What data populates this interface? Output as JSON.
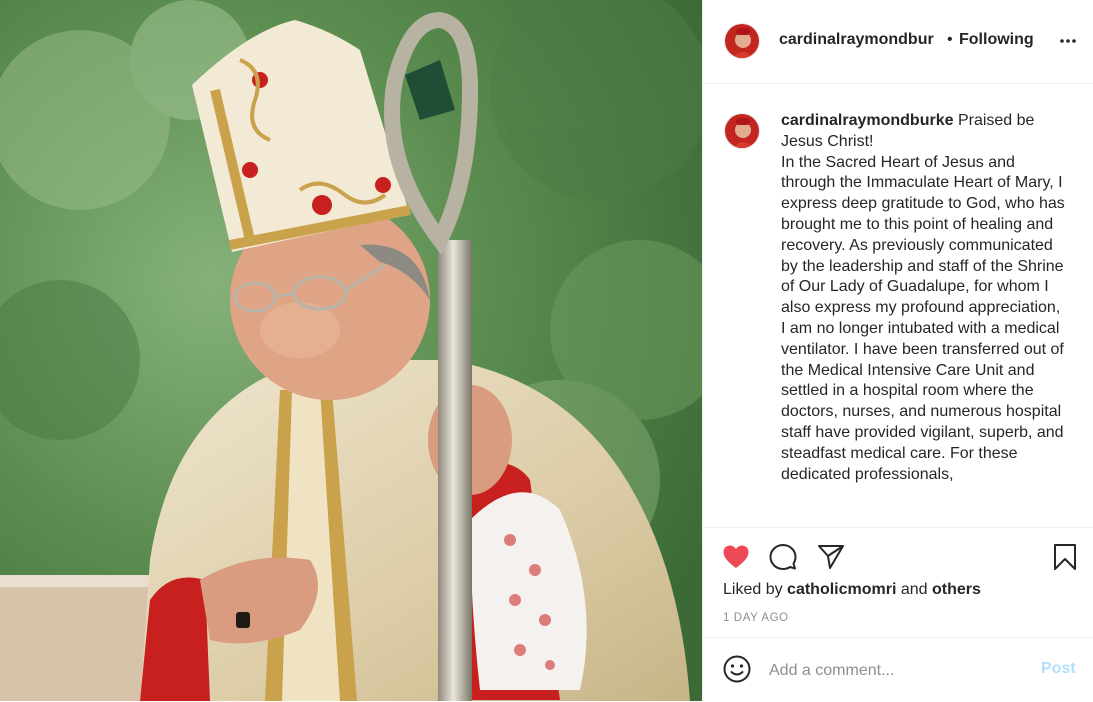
{
  "post": {
    "username": "cardinalraymondbur",
    "separator": "•",
    "follow_status": "Following",
    "more_icon": "more-horizontal-icon"
  },
  "caption": {
    "username": "cardinalraymondburke",
    "text": "Praised be Jesus Christ!\nIn the Sacred Heart of Jesus and through the Immaculate Heart of Mary, I express deep gratitude to God, who has brought me to this point of healing and recovery. As previously communicated by the leadership and staff of the Shrine of Our Lady of Guadalupe, for whom I also express my profound appreciation, I am no longer intubated with a medical ventilator. I have been transferred out of the Medical Intensive Care Unit and settled in a hospital room where the doctors, nurses, and numerous hospital staff have provided vigilant, superb, and steadfast medical care. For these dedicated professionals,"
  },
  "actions": {
    "liked_prefix": "Liked by",
    "liked_user": "catholicmomri",
    "liked_and": "and",
    "liked_others": "others",
    "timestamp": "1 DAY AGO"
  },
  "comment_box": {
    "placeholder": "Add a comment...",
    "post_label": "Post"
  },
  "colors": {
    "like_red": "#ed4956",
    "post_disabled": "#b2dffc"
  }
}
